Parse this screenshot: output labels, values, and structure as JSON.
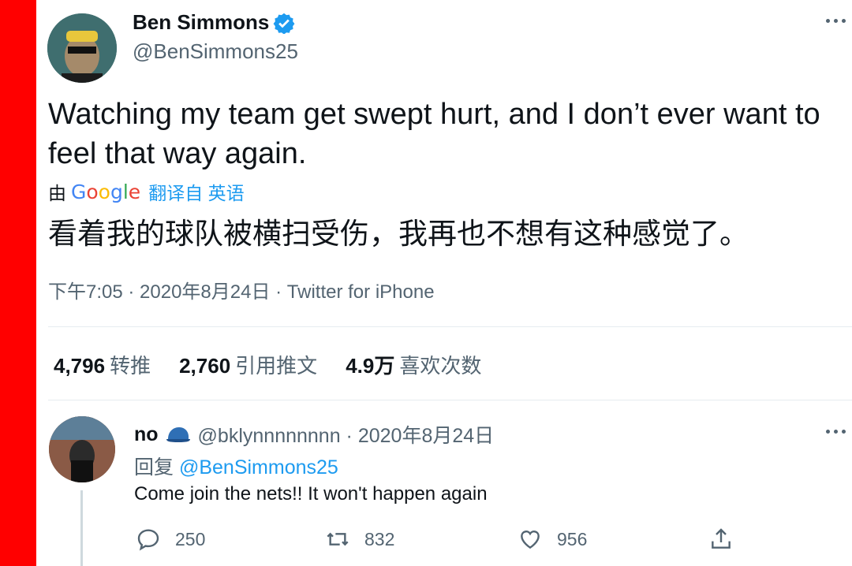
{
  "colors": {
    "accent": "#1d9bf0",
    "sidebar_stripe": "#ff0000",
    "muted": "#536471"
  },
  "tweet": {
    "author_name": "Ben Simmons",
    "author_handle": "@BenSimmons25",
    "text": "Watching my team get swept hurt, and I don’t ever want to feel that way again.",
    "translate_by": "由",
    "translate_brand": "Google",
    "translate_label": "翻译自 英语",
    "translated_text": "看着我的球队被横扫受伤，我再也不想有这种感觉了。",
    "meta": "下午7:05 · 2020年8月24日 · Twitter for iPhone",
    "stats": [
      {
        "value": "4,796",
        "label": "转推"
      },
      {
        "value": "2,760",
        "label": "引用推文"
      },
      {
        "value": "4.9万",
        "label": "喜欢次数"
      }
    ]
  },
  "reply": {
    "name": "no",
    "handle_date": "@bklynnnnnnnn · 2020年8月24日",
    "reply_prefix": "回复",
    "reply_mention": "@BenSimmons25",
    "text": "Come join the nets!! It won't happen again",
    "actions": {
      "reply_count": "250",
      "retweet_count": "832",
      "like_count": "956"
    }
  },
  "icons": [
    "verified-badge-icon",
    "more-options-icon",
    "baseball-cap-icon",
    "reply-icon",
    "retweet-icon",
    "like-icon",
    "share-icon"
  ]
}
